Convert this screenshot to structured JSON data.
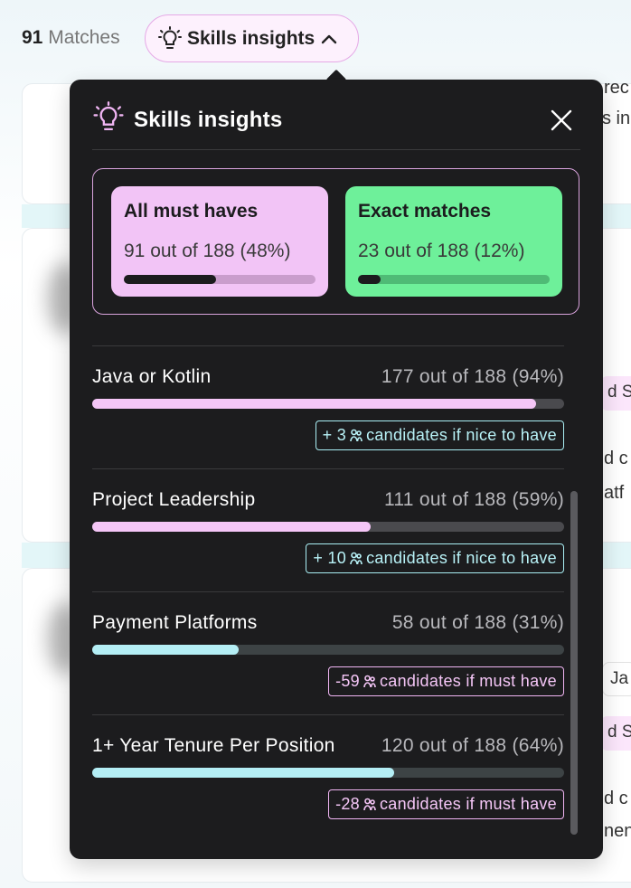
{
  "header": {
    "matches_count": "91",
    "matches_label": "Matches",
    "insights_button": "Skills insights"
  },
  "background": {
    "fragments": [
      "rec",
      "s in",
      "d Sy",
      "d c",
      "atf",
      "Ja",
      "d Sy",
      "d c",
      "nen"
    ]
  },
  "popover": {
    "title": "Skills insights",
    "summary": {
      "must_haves": {
        "label": "All must haves",
        "value": "91 out of 188 (48%)",
        "fraction": 0.48
      },
      "exact": {
        "label": "Exact matches",
        "value": "23 out of 188 (12%)",
        "fraction": 0.12
      }
    },
    "skills": [
      {
        "name": "Java or Kotlin",
        "count": "177 out of 188 (94%)",
        "fraction": 0.94,
        "bar_color": "#f5c6f7",
        "hint": "+ 3",
        "hint_text": "candidates if nice to have",
        "hint_style": "cyan"
      },
      {
        "name": "Project Leadership",
        "count": "111 out of 188 (59%)",
        "fraction": 0.59,
        "bar_color": "#f5c6f7",
        "hint": "+ 10",
        "hint_text": "candidates if nice to have",
        "hint_style": "cyan"
      },
      {
        "name": "Payment Platforms",
        "count": "58 out of 188 (31%)",
        "fraction": 0.31,
        "bar_color": "#b4eef5",
        "hint": "-59",
        "hint_text": "candidates if must have",
        "hint_style": "pink"
      },
      {
        "name": "1+ Year Tenure Per Position",
        "count": "120 out of 188 (64%)",
        "fraction": 0.64,
        "bar_color": "#b4eef5",
        "hint": "-28",
        "hint_text": "candidates if must have",
        "hint_style": "pink"
      }
    ]
  },
  "colors": {
    "must_have_card": "#f2c4f6",
    "exact_card": "#6ef09a",
    "popover_bg": "#1c1c1e",
    "pill_border": "#e5a9e6"
  },
  "icons": [
    "lightbulb-icon",
    "chevron-up-icon",
    "close-icon",
    "people-icon"
  ]
}
